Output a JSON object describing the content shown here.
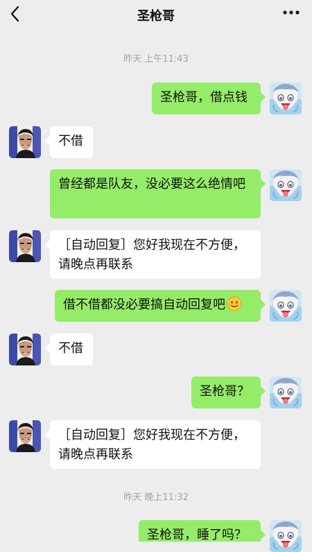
{
  "header": {
    "title": "圣枪哥"
  },
  "timestamps": [
    "昨天 上午11:43",
    "昨天 晚上11:32"
  ],
  "messages": [
    {
      "side": "right",
      "text": "圣枪哥，借点钱"
    },
    {
      "side": "left",
      "text": "不借"
    },
    {
      "side": "right",
      "text": "曾经都是队友，没必要这么绝情吧"
    },
    {
      "side": "left",
      "text": "［自动回复］您好我现在不方便，请晚点再联系"
    },
    {
      "side": "right",
      "text": "借不借都没必要搞自动回复吧",
      "emoji": "smiling-face"
    },
    {
      "side": "left",
      "text": "不借"
    },
    {
      "side": "right",
      "text": "圣枪哥？"
    },
    {
      "side": "left",
      "text": "［自动回复］您好我现在不方便，请晚点再联系"
    },
    {
      "side": "right",
      "text": "圣枪哥，睡了吗？"
    }
  ],
  "colors": {
    "background": "#ededed",
    "bubble_self": "#95ec69",
    "bubble_other": "#ffffff",
    "timestamp": "#a3a3a3"
  }
}
